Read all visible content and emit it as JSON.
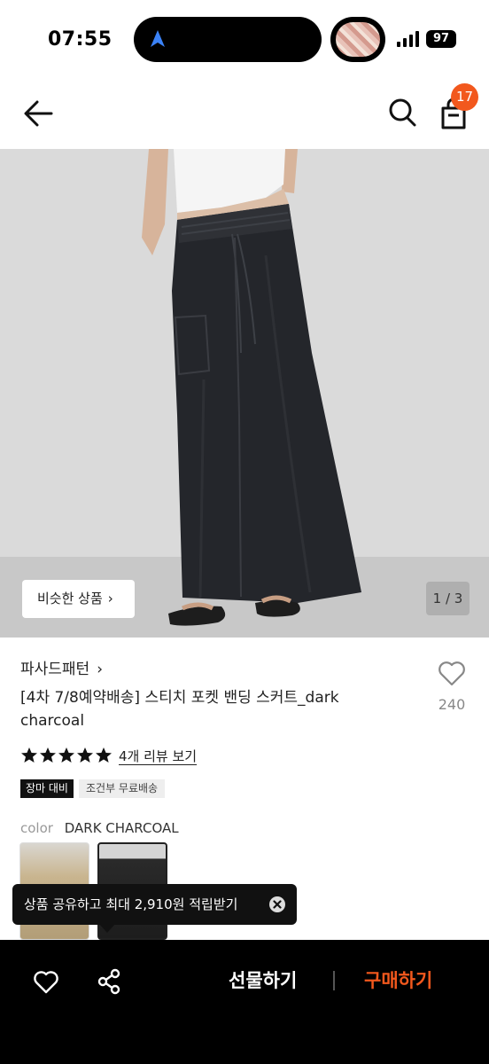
{
  "status_bar": {
    "time": "07:55",
    "battery": "97"
  },
  "header": {
    "cart_count": "17"
  },
  "product": {
    "similar_button": "비슷한 상품",
    "image_counter": "1 / 3",
    "brand": "파사드패턴",
    "title": "[4차 7/8예약배송] 스티치 포켓 밴딩 스커트_dark charcoal",
    "like_count": "240",
    "rating": 5,
    "review_link": "4개 리뷰 보기",
    "tags": [
      "장마 대비",
      "조건부 무료배송"
    ],
    "color_label": "color",
    "color_value": "DARK CHARCOAL"
  },
  "toast": {
    "message": "상품 공유하고 최대 2,910원 적립받기"
  },
  "bottom_bar": {
    "gift_label": "선물하기",
    "buy_label": "구매하기"
  },
  "colors": {
    "accent": "#f2581d",
    "bottom_bar": "#000000"
  }
}
